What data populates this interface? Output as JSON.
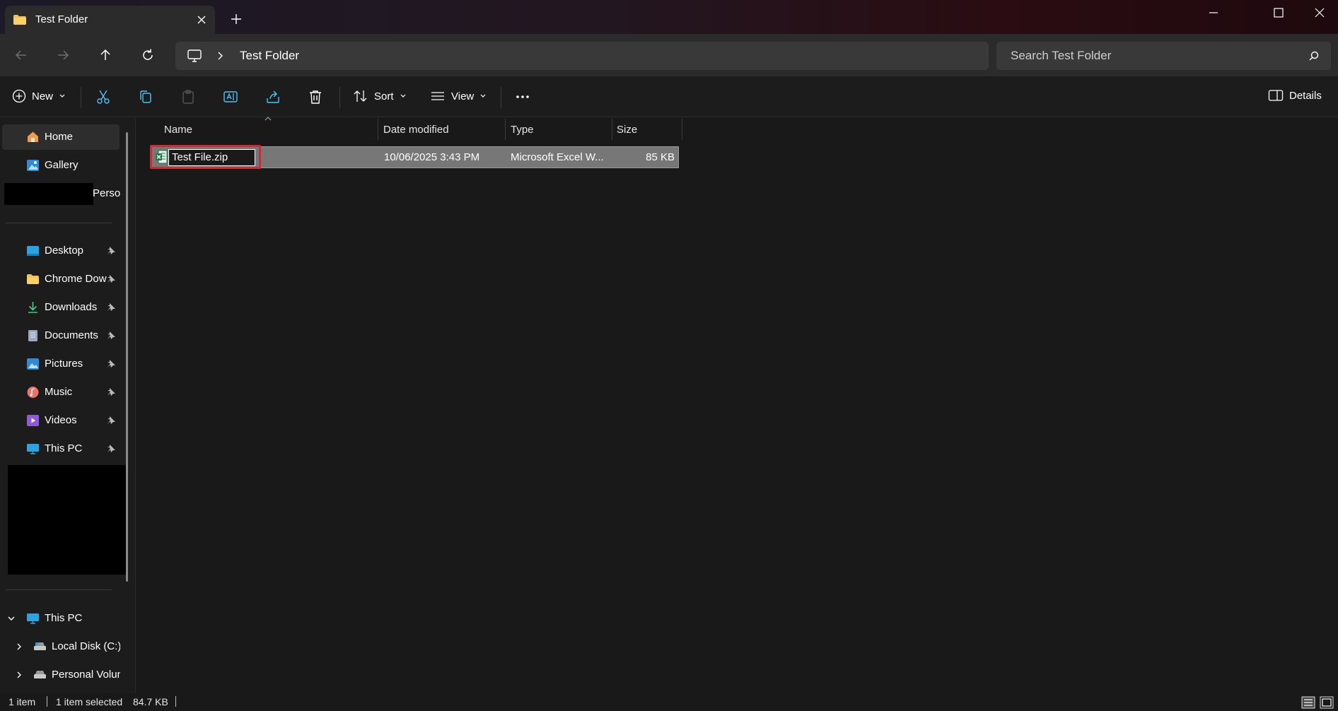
{
  "window": {
    "tab_title": "Test Folder"
  },
  "nav": {
    "path_segment": "Test Folder",
    "search_placeholder": "Search Test Folder"
  },
  "commands": {
    "new_label": "New",
    "sort_label": "Sort",
    "view_label": "View",
    "details_label": "Details"
  },
  "sidebar": {
    "home": "Home",
    "gallery": "Gallery",
    "personal_partial": "Perso",
    "quick_access": [
      {
        "label": "Desktop",
        "icon": "desktop-icon"
      },
      {
        "label": "Chrome Dow",
        "icon": "folder-icon"
      },
      {
        "label": "Downloads",
        "icon": "downloads-icon"
      },
      {
        "label": "Documents",
        "icon": "documents-icon"
      },
      {
        "label": "Pictures",
        "icon": "pictures-icon"
      },
      {
        "label": "Music",
        "icon": "music-icon"
      },
      {
        "label": "Videos",
        "icon": "videos-icon"
      },
      {
        "label": "This PC",
        "icon": "pc-icon"
      }
    ],
    "this_pc": "This PC",
    "local_disk": "Local Disk (C:)",
    "personal_volume": "Personal Volun"
  },
  "columns": {
    "name": "Name",
    "date_modified": "Date modified",
    "type": "Type",
    "size": "Size"
  },
  "files": [
    {
      "name": "Test File.zip",
      "date_modified": "10/06/2025 3:43 PM",
      "type": "Microsoft Excel W...",
      "size": "85 KB"
    }
  ],
  "status": {
    "item_count": "1 item",
    "selected": "1 item selected",
    "selected_size": "84.7 KB"
  },
  "colors": {
    "accent_highlight": "#d22a32",
    "excel_green": "#1d7a44",
    "folder_yellow": "#f2c14e"
  }
}
